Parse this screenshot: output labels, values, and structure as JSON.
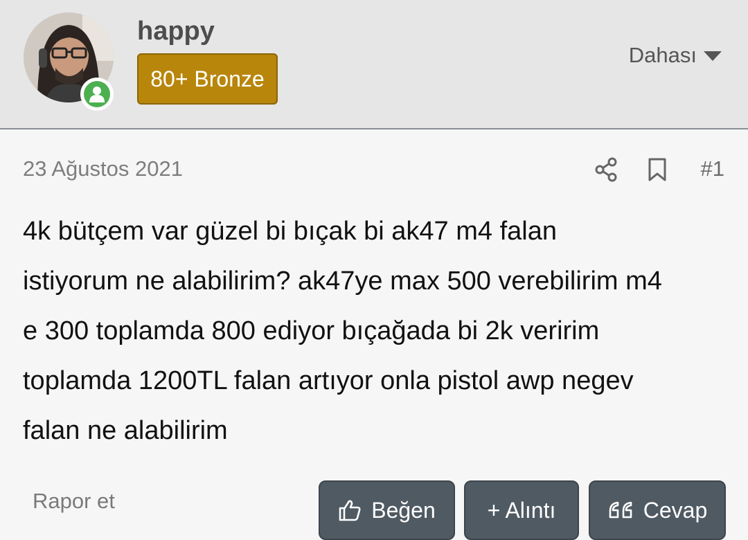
{
  "post": {
    "username": "happy",
    "badge": "80+ Bronze",
    "more_label": "Dahası",
    "date": "23 Ağustos 2021",
    "post_number": "#1",
    "body": "4k bütçem var güzel bi bıçak bi ak47 m4 falan\nistiyorum ne alabilirim? ak47ye max 500 verebilirim m4\ne 300 toplamda 800 ediyor bıçağada bi 2k veririm\ntoplamda 1200TL falan artıyor onla pistol awp negev\nfalan ne alabilirim",
    "report_label": "Rapor et"
  },
  "actions": {
    "like_label": "Beğen",
    "quote_label": "+ Alıntı",
    "reply_label": "Cevap"
  },
  "colors": {
    "badge": "#b8860b",
    "online": "#4caf50",
    "button": "#505a63"
  },
  "icons": [
    "user-online-icon",
    "share-icon",
    "bookmark-icon",
    "thumbs-up-icon",
    "quote-icon",
    "chevron-down-icon"
  ]
}
